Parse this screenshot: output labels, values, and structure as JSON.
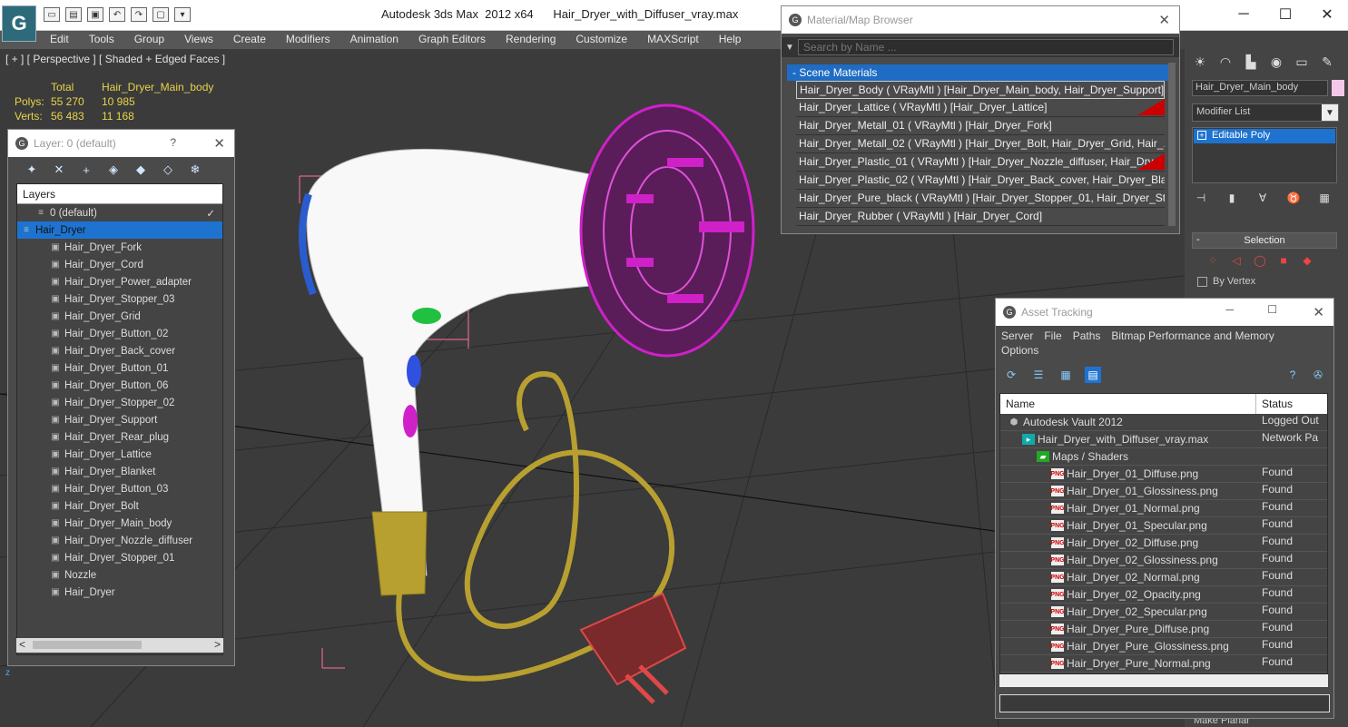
{
  "window": {
    "app_title": "Autodesk 3ds Max  2012 x64",
    "file_name": "Hair_Dryer_with_Diffuser_vray.max",
    "logo_glyph": "G"
  },
  "menu": [
    "Edit",
    "Tools",
    "Group",
    "Views",
    "Create",
    "Modifiers",
    "Animation",
    "Graph Editors",
    "Rendering",
    "Customize",
    "MAXScript",
    "Help"
  ],
  "viewport": {
    "label": "[ + ] [ Perspective ] [ Shaded + Edged Faces ]",
    "stats": {
      "header_total": "Total",
      "header_object": "Hair_Dryer_Main_body",
      "polys_label": "Polys:",
      "polys_total": "55 270",
      "polys_object": "10 985",
      "verts_label": "Verts:",
      "verts_total": "56 483",
      "verts_object": "11 168"
    },
    "axis_label": "z"
  },
  "layer_window": {
    "title": "Layer: 0 (default)",
    "help": "?",
    "header": "Layers",
    "rows": [
      {
        "label": "0 (default)",
        "indent": 1,
        "check": "✓"
      },
      {
        "label": "Hair_Dryer",
        "indent": 0,
        "selected": true
      },
      {
        "label": "Hair_Dryer_Fork",
        "indent": 2
      },
      {
        "label": "Hair_Dryer_Cord",
        "indent": 2
      },
      {
        "label": "Hair_Dryer_Power_adapter",
        "indent": 2
      },
      {
        "label": "Hair_Dryer_Stopper_03",
        "indent": 2
      },
      {
        "label": "Hair_Dryer_Grid",
        "indent": 2
      },
      {
        "label": "Hair_Dryer_Button_02",
        "indent": 2
      },
      {
        "label": "Hair_Dryer_Back_cover",
        "indent": 2
      },
      {
        "label": "Hair_Dryer_Button_01",
        "indent": 2
      },
      {
        "label": "Hair_Dryer_Button_06",
        "indent": 2
      },
      {
        "label": "Hair_Dryer_Stopper_02",
        "indent": 2
      },
      {
        "label": "Hair_Dryer_Support",
        "indent": 2
      },
      {
        "label": "Hair_Dryer_Rear_plug",
        "indent": 2
      },
      {
        "label": "Hair_Dryer_Lattice",
        "indent": 2
      },
      {
        "label": "Hair_Dryer_Blanket",
        "indent": 2
      },
      {
        "label": "Hair_Dryer_Button_03",
        "indent": 2
      },
      {
        "label": "Hair_Dryer_Bolt",
        "indent": 2
      },
      {
        "label": "Hair_Dryer_Main_body",
        "indent": 2
      },
      {
        "label": "Hair_Dryer_Nozzle_diffuser",
        "indent": 2
      },
      {
        "label": "Hair_Dryer_Stopper_01",
        "indent": 2
      },
      {
        "label": "Nozzle",
        "indent": 2
      },
      {
        "label": "Hair_Dryer",
        "indent": 2
      }
    ],
    "scroll_left": "<",
    "scroll_right": ">"
  },
  "material_browser": {
    "title": "Material/Map Browser",
    "search_placeholder": "Search by Name ...",
    "section": "- Scene Materials",
    "rows": [
      {
        "text": "Hair_Dryer_Body  ( VRayMtl )  [Hair_Dryer_Main_body, Hair_Dryer_Support]",
        "highlight": true
      },
      {
        "text": "Hair_Dryer_Lattice  ( VRayMtl )  [Hair_Dryer_Lattice]",
        "flag": true
      },
      {
        "text": "Hair_Dryer_Metall_01  ( VRayMtl )  [Hair_Dryer_Fork]"
      },
      {
        "text": "Hair_Dryer_Metall_02  ( VRayMtl )  [Hair_Dryer_Bolt, Hair_Dryer_Grid, Hair_..."
      },
      {
        "text": "Hair_Dryer_Plastic_01  ( VRayMtl )  [Hair_Dryer_Nozzle_diffuser, Hair_Dryer_...",
        "flag": true
      },
      {
        "text": "Hair_Dryer_Plastic_02  ( VRayMtl )  [Hair_Dryer_Back_cover, Hair_Dryer_Bla..."
      },
      {
        "text": "Hair_Dryer_Pure_black  ( VRayMtl )  [Hair_Dryer_Stopper_01, Hair_Dryer_St..."
      },
      {
        "text": "Hair_Dryer_Rubber  ( VRayMtl )  [Hair_Dryer_Cord]"
      }
    ]
  },
  "command_panel": {
    "object_name": "Hair_Dryer_Main_body",
    "object_color": "#f4c8e8",
    "modifier_list": "Modifier List",
    "stack_item": "Editable Poly",
    "rollout": "Selection",
    "rollout_toggle": "-",
    "by_vertex": "By Vertex",
    "bottom_label": "Make Planar"
  },
  "asset_tracking": {
    "title": "Asset Tracking",
    "menu": [
      "Server",
      "File",
      "Paths",
      "Bitmap Performance and Memory",
      "Options"
    ],
    "col_name": "Name",
    "col_status": "Status",
    "rows": [
      {
        "name": "Autodesk Vault 2012",
        "status": "Logged Out",
        "indent": 1,
        "icon": "vault"
      },
      {
        "name": "Hair_Dryer_with_Diffuser_vray.max",
        "status": "Network Pa",
        "indent": 2,
        "icon": "max"
      },
      {
        "name": "Maps / Shaders",
        "status": "",
        "indent": 3,
        "icon": "maps"
      },
      {
        "name": "Hair_Dryer_01_Diffuse.png",
        "status": "Found",
        "indent": 4,
        "icon": "png"
      },
      {
        "name": "Hair_Dryer_01_Glossiness.png",
        "status": "Found",
        "indent": 4,
        "icon": "png"
      },
      {
        "name": "Hair_Dryer_01_Normal.png",
        "status": "Found",
        "indent": 4,
        "icon": "png"
      },
      {
        "name": "Hair_Dryer_01_Specular.png",
        "status": "Found",
        "indent": 4,
        "icon": "png"
      },
      {
        "name": "Hair_Dryer_02_Diffuse.png",
        "status": "Found",
        "indent": 4,
        "icon": "png"
      },
      {
        "name": "Hair_Dryer_02_Glossiness.png",
        "status": "Found",
        "indent": 4,
        "icon": "png"
      },
      {
        "name": "Hair_Dryer_02_Normal.png",
        "status": "Found",
        "indent": 4,
        "icon": "png"
      },
      {
        "name": "Hair_Dryer_02_Opacity.png",
        "status": "Found",
        "indent": 4,
        "icon": "png"
      },
      {
        "name": "Hair_Dryer_02_Specular.png",
        "status": "Found",
        "indent": 4,
        "icon": "png"
      },
      {
        "name": "Hair_Dryer_Pure_Diffuse.png",
        "status": "Found",
        "indent": 4,
        "icon": "png"
      },
      {
        "name": "Hair_Dryer_Pure_Glossiness.png",
        "status": "Found",
        "indent": 4,
        "icon": "png"
      },
      {
        "name": "Hair_Dryer_Pure_Normal.png",
        "status": "Found",
        "indent": 4,
        "icon": "png"
      }
    ]
  },
  "colors": {
    "selection_blue": "#1e73d0",
    "stats_yellow": "#e8d44a",
    "body_white": "#ffffff",
    "diffuser_magenta": "#d020c8",
    "cord_yellow": "#b8a030",
    "plug_red": "#e04848"
  }
}
